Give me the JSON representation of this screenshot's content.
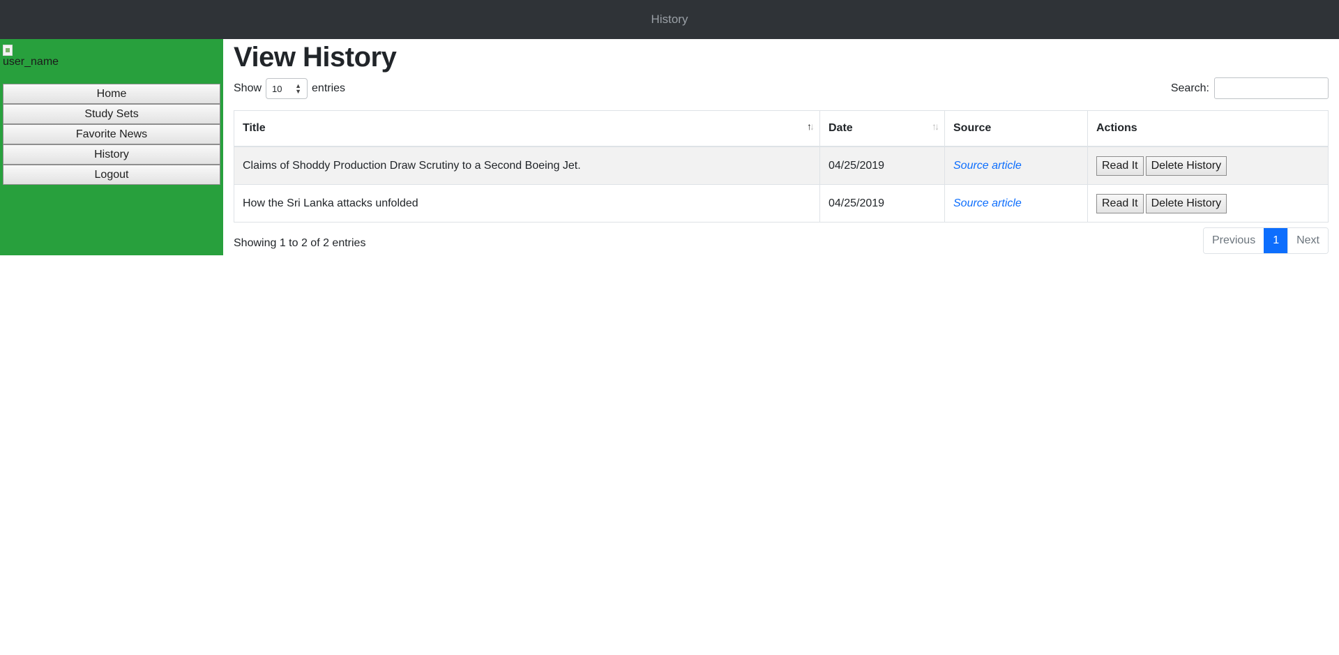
{
  "topbar": {
    "title": "History"
  },
  "sidebar": {
    "avatar_alt": "user_name",
    "items": [
      {
        "label": "Home"
      },
      {
        "label": "Study Sets"
      },
      {
        "label": "Favorite News"
      },
      {
        "label": "History"
      },
      {
        "label": "Logout"
      }
    ]
  },
  "main": {
    "heading": "View History",
    "length": {
      "show_label": "Show",
      "value": "10",
      "entries_label": "entries"
    },
    "search": {
      "label": "Search:",
      "value": ""
    },
    "table": {
      "headers": [
        "Title",
        "Date",
        "Source",
        "Actions"
      ],
      "rows": [
        {
          "title": "Claims of Shoddy Production Draw Scrutiny to a Second Boeing Jet.",
          "date": "04/25/2019",
          "source": "Source article",
          "read_label": "Read It",
          "delete_label": "Delete History"
        },
        {
          "title": "How the Sri Lanka attacks unfolded",
          "date": "04/25/2019",
          "source": "Source article",
          "read_label": "Read It",
          "delete_label": "Delete History"
        }
      ]
    },
    "info": "Showing 1 to 2 of 2 entries",
    "pagination": {
      "previous": "Previous",
      "current": "1",
      "next": "Next"
    }
  },
  "colors": {
    "topbar_bg": "#2f3337",
    "sidebar_bg": "#28a03d",
    "accent": "#0d6efd"
  }
}
